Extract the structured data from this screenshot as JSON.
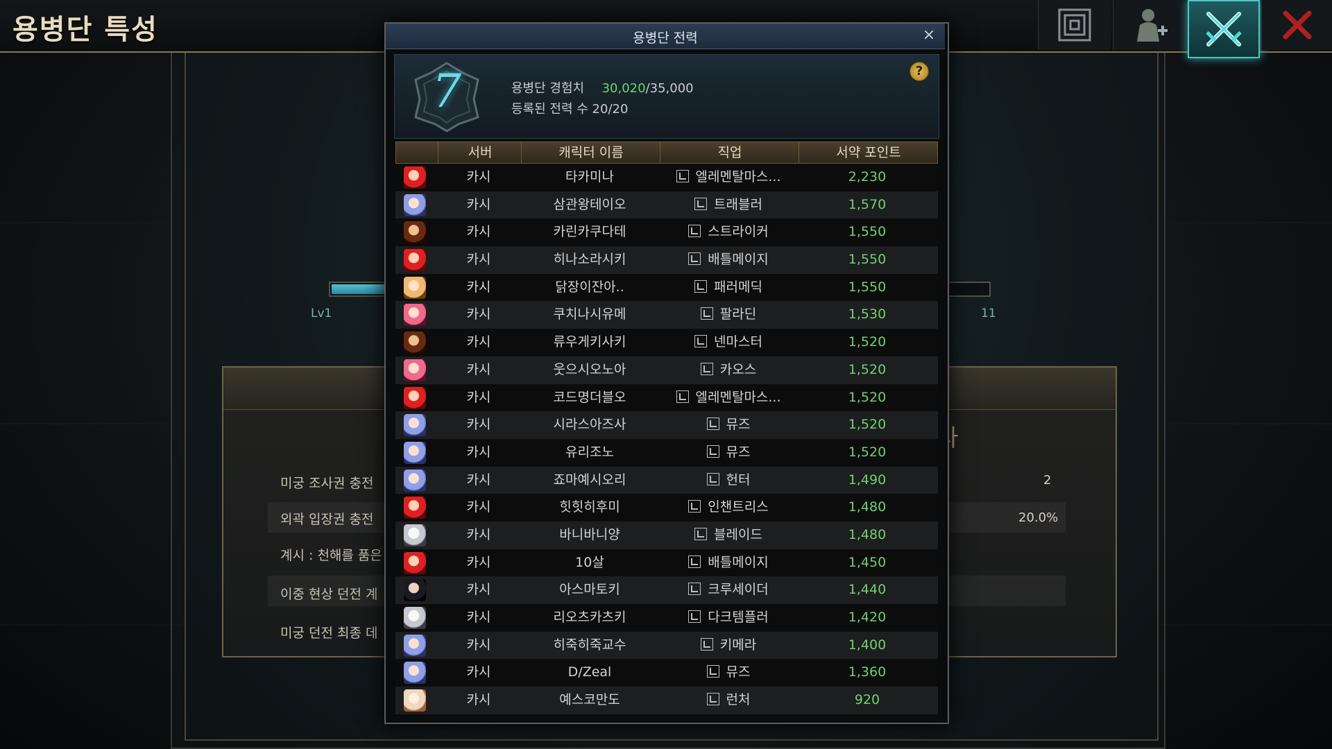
{
  "page": {
    "title": "용병단 특성"
  },
  "background": {
    "level_left": "Lv1",
    "level_right": "11",
    "progress_fraction": 0.08,
    "bonuses": [
      {
        "label": "미궁 조사권 충전",
        "value": "2"
      },
      {
        "label": "외곽 입장권 충전",
        "value": "20.0%"
      },
      {
        "label": "계시 : 천해를 품은",
        "value": ""
      },
      {
        "label": "이중 현상 던전 계",
        "value": ""
      },
      {
        "label": "미궁 던전 최종 데",
        "value": ""
      }
    ],
    "partial_char": "라"
  },
  "top_icons": [
    {
      "name": "maze-icon",
      "active": false
    },
    {
      "name": "add-character-icon",
      "active": false
    },
    {
      "name": "crossed-swords-icon",
      "active": true
    },
    {
      "name": "close-icon",
      "active": false
    }
  ],
  "modal": {
    "title": "용병단 전력",
    "close_glyph": "×",
    "help_glyph": "?",
    "level": "7",
    "exp_label": "용병단 경험치",
    "exp_current": "30,020",
    "exp_max": "/35,000",
    "registered_label": "등록된 전력 수",
    "registered_value": "20/20",
    "columns": [
      "서버",
      "캐릭터 이름",
      "직업",
      "서약 포인트"
    ],
    "rows": [
      {
        "avatar": "red",
        "server": "카시",
        "name": "타카미나",
        "job": "엘레멘탈마스...",
        "points": "2,230"
      },
      {
        "avatar": "blue",
        "server": "카시",
        "name": "삼관왕테이오",
        "job": "트래블러",
        "points": "1,570"
      },
      {
        "avatar": "brown",
        "server": "카시",
        "name": "카린카쿠다테",
        "job": "스트라이커",
        "points": "1,550"
      },
      {
        "avatar": "red",
        "server": "카시",
        "name": "히나소라시키",
        "job": "배틀메이지",
        "points": "1,550"
      },
      {
        "avatar": "blonde",
        "server": "카시",
        "name": "닭장이잔아..",
        "job": "패러메딕",
        "points": "1,550"
      },
      {
        "avatar": "pink",
        "server": "카시",
        "name": "쿠치나시유메",
        "job": "팔라딘",
        "points": "1,530"
      },
      {
        "avatar": "brown",
        "server": "카시",
        "name": "류우게키사키",
        "job": "넨마스터",
        "points": "1,520"
      },
      {
        "avatar": "pink",
        "server": "카시",
        "name": "웃으시오노아",
        "job": "카오스",
        "points": "1,520"
      },
      {
        "avatar": "red",
        "server": "카시",
        "name": "코드명더블오",
        "job": "엘레멘탈마스...",
        "points": "1,520"
      },
      {
        "avatar": "blue",
        "server": "카시",
        "name": "시라스아즈사",
        "job": "뮤즈",
        "points": "1,520"
      },
      {
        "avatar": "blue",
        "server": "카시",
        "name": "유리조노",
        "job": "뮤즈",
        "points": "1,520"
      },
      {
        "avatar": "blue",
        "server": "카시",
        "name": "죠마예시오리",
        "job": "헌터",
        "points": "1,490"
      },
      {
        "avatar": "red",
        "server": "카시",
        "name": "힛힛히후미",
        "job": "인챈트리스",
        "points": "1,480"
      },
      {
        "avatar": "white",
        "server": "카시",
        "name": "바니바니양",
        "job": "블레이드",
        "points": "1,480"
      },
      {
        "avatar": "red",
        "server": "카시",
        "name": "10살",
        "job": "배틀메이지",
        "points": "1,450"
      },
      {
        "avatar": "dark",
        "server": "카시",
        "name": "아스마토키",
        "job": "크루세이더",
        "points": "1,440"
      },
      {
        "avatar": "white",
        "server": "카시",
        "name": "리오츠카츠키",
        "job": "다크템플러",
        "points": "1,420"
      },
      {
        "avatar": "blue",
        "server": "카시",
        "name": "히죽히죽교수",
        "job": "키메라",
        "points": "1,400"
      },
      {
        "avatar": "blue",
        "server": "카시",
        "name": "D/Zeal",
        "job": "뮤즈",
        "points": "1,360"
      },
      {
        "avatar": "cream",
        "server": "카시",
        "name": "예스코만도",
        "job": "런처",
        "points": "920"
      }
    ]
  }
}
